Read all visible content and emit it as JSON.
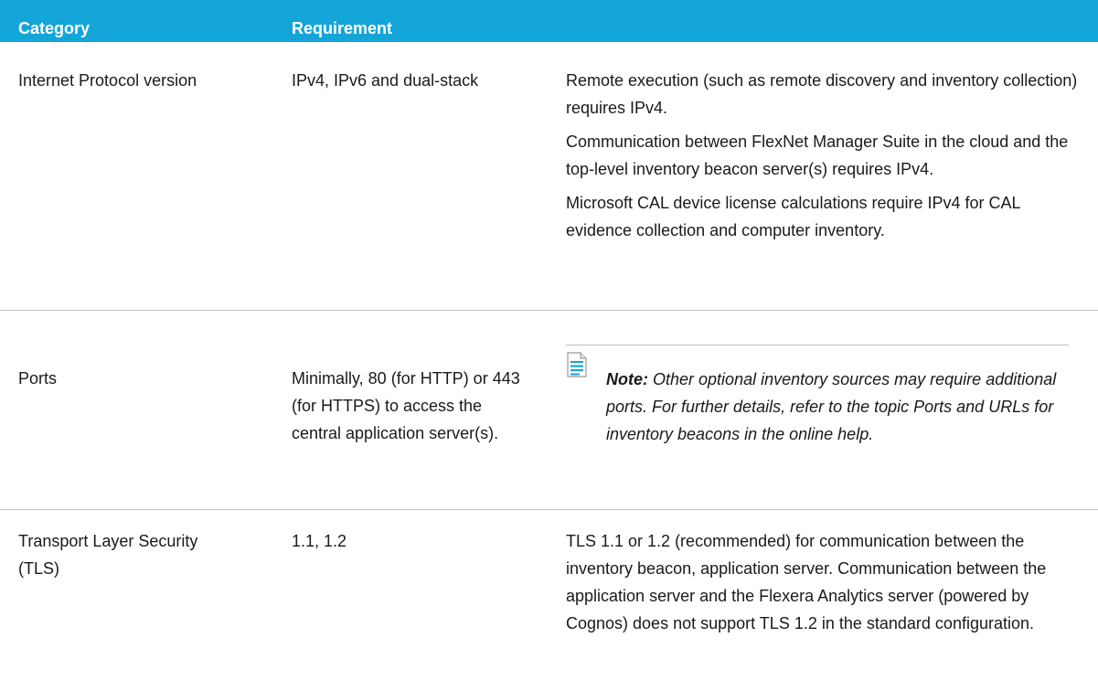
{
  "header": {
    "category_label": "Category",
    "requirement_label": "Requirement"
  },
  "rows": [
    {
      "category": "Internet Protocol version",
      "requirement": "IPv4, IPv6 and dual-stack",
      "notes": [
        "Remote execution (such as remote discovery and inventory collection) requires IPv4.",
        "Communication between FlexNet Manager Suite in the cloud and the top-level inventory beacon server(s) requires IPv4.",
        "Microsoft CAL device license calculations require IPv4 for CAL evidence collection and computer inventory."
      ]
    },
    {
      "category": "Ports",
      "requirement": "Minimally, 80 (for HTTP) or 443 (for HTTPS) to access the central application server(s).",
      "note_label": "Note:",
      "note_text": "Other optional inventory sources may require additional ports. For further details, refer to the topic Ports and URLs for inventory beacons in the online help.",
      "note_icon": "document-note-icon"
    },
    {
      "category": "Transport Layer Security (TLS)",
      "requirement": "1.1, 1.2",
      "notes": [
        "TLS 1.1 or 1.2 (recommended) for communication between the inventory beacon, application server. Communication between the application server and the Flexera Analytics server (powered by Cognos) does not support TLS 1.2 in the standard configuration."
      ]
    }
  ],
  "colors": {
    "header_bg": "#14a5d8",
    "header_text": "#ffffff",
    "rule": "#bfbfbf",
    "note_icon": "#1fa3d8"
  }
}
